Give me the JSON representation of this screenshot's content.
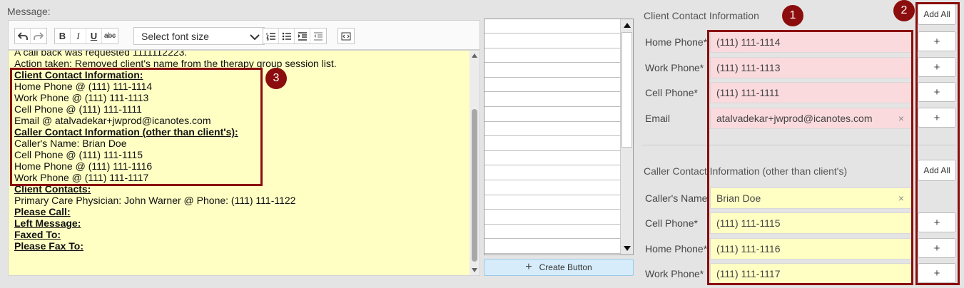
{
  "message_label": "Message:",
  "toolbar": {
    "undo_icon": "undo-icon",
    "redo_icon": "redo-icon",
    "bold_label": "B",
    "italic_label": "I",
    "underline_label": "U",
    "strike_label": "abc",
    "font_size_value": "Select font size",
    "ordered_list_icon": "ordered-list-icon",
    "bullet_list_icon": "bullet-list-icon",
    "indent_icon": "indent-icon",
    "outdent_icon": "outdent-icon",
    "source_icon": "source-code-icon"
  },
  "editor": {
    "lines": [
      {
        "text": "A call back was requested 1111112223.",
        "style": "normal"
      },
      {
        "text": "Action taken: Removed client's name from the therapy group session list.",
        "style": "normal"
      },
      {
        "text": "Client Contact Information:",
        "style": "heading"
      },
      {
        "text": "Home Phone @ (111) 111-1114",
        "style": "normal"
      },
      {
        "text": "Work Phone @ (111) 111-1113",
        "style": "normal"
      },
      {
        "text": "Cell Phone @ (111) 111-1111",
        "style": "normal"
      },
      {
        "text": "Email @ atalvadekar+jwprod@icanotes.com",
        "style": "normal"
      },
      {
        "text": "Caller Contact Information (other than client's):",
        "style": "heading"
      },
      {
        "text": "Caller's Name: Brian Doe",
        "style": "normal"
      },
      {
        "text": "Cell Phone @ (111) 111-1115",
        "style": "normal"
      },
      {
        "text": "Home Phone @ (111) 111-1116",
        "style": "normal"
      },
      {
        "text": "Work Phone @ (111) 111-1117",
        "style": "normal"
      },
      {
        "text": "Client Contacts:",
        "style": "heading"
      },
      {
        "text": "Primary Care Physician: John Warner @ Phone: (111) 111-1122",
        "style": "normal"
      },
      {
        "text": "Please Call:",
        "style": "heading"
      },
      {
        "text": "Left Message:",
        "style": "heading"
      },
      {
        "text": "Faxed To:",
        "style": "heading"
      },
      {
        "text": "Please Fax To:",
        "style": "heading"
      }
    ]
  },
  "middle_list": {
    "row_count": 16,
    "create_button_label": "Create Button"
  },
  "client_contact": {
    "title": "Client Contact Information",
    "add_all_label": "Add All",
    "fields": [
      {
        "label": "Home Phone*",
        "value": "(111) 111-1114",
        "clearable": false
      },
      {
        "label": "Work Phone*",
        "value": "(111) 111-1113",
        "clearable": false
      },
      {
        "label": "Cell Phone*",
        "value": "(111) 111-1111",
        "clearable": false
      },
      {
        "label": "Email",
        "value": "atalvadekar+jwprod@icanotes.com",
        "clearable": true
      }
    ],
    "add_label": "+"
  },
  "caller_contact": {
    "title": "Caller Contact Information (other than client's)",
    "add_all_label": "Add All",
    "fields": [
      {
        "label": "Caller's Name",
        "value": "Brian Doe",
        "clearable": true
      },
      {
        "label": "Cell Phone*",
        "value": "(111) 111-1115",
        "clearable": false
      },
      {
        "label": "Home Phone*",
        "value": "(111) 111-1116",
        "clearable": false
      },
      {
        "label": "Work Phone*",
        "value": "(111) 111-1117",
        "clearable": false
      }
    ],
    "add_label": "+"
  },
  "clear_glyph": "×",
  "annotations": {
    "badge_1": "1",
    "badge_2": "2",
    "badge_3": "3",
    "highlight_color": "#8b0d0d"
  },
  "colors": {
    "editor_bg": "#ffffc4",
    "client_field_bg": "#fadadd",
    "caller_field_bg": "#ffffc4",
    "create_button_bg": "#d6ecfa"
  }
}
